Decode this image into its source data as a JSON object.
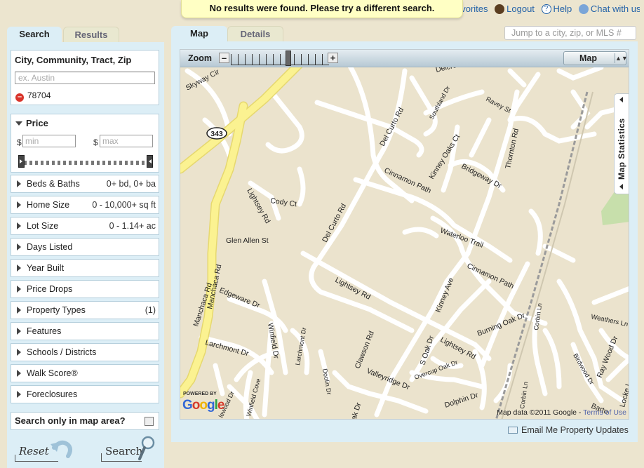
{
  "notice": "No results were found. Please try a different search.",
  "topnav": {
    "favorites": "avorites",
    "logout": "Logout",
    "help": "Help",
    "chat": "Chat with us"
  },
  "left_tabs": [
    "Search",
    "Results"
  ],
  "right_tabs": [
    "Map",
    "Details"
  ],
  "jump_placeholder": "Jump to a city, zip, or MLS #",
  "location": {
    "title": "City, Community, Tract, Zip",
    "placeholder": "ex. Austin",
    "chip": "78704"
  },
  "price": {
    "title": "Price",
    "min_placeholder": "min",
    "max_placeholder": "max",
    "currency": "$"
  },
  "filters": [
    {
      "label": "Beds & Baths",
      "value": "0+ bd, 0+ ba"
    },
    {
      "label": "Home Size",
      "value": "0 - 10,000+ sq ft"
    },
    {
      "label": "Lot Size",
      "value": "0 - 1.14+ ac"
    },
    {
      "label": "Days Listed",
      "value": ""
    },
    {
      "label": "Year Built",
      "value": ""
    },
    {
      "label": "Price Drops",
      "value": ""
    },
    {
      "label": "Property Types",
      "value": "(1)"
    },
    {
      "label": "Features",
      "value": ""
    },
    {
      "label": "Schools / Districts",
      "value": ""
    },
    {
      "label": "Walk Score®",
      "value": ""
    },
    {
      "label": "Foreclosures",
      "value": ""
    }
  ],
  "map_area_label": "Search only in map area?",
  "buttons": {
    "reset": "Reset",
    "search": "Search"
  },
  "map": {
    "zoom_label": "Zoom",
    "zoom_minus": "–",
    "zoom_plus": "+",
    "type": "Map",
    "stats": "Map Statistics",
    "powered": "POWERED BY",
    "google": "Google",
    "data_text": "Map data ©2011 Google -",
    "terms": "Terms of Use",
    "highway": "343",
    "streets": {
      "manchaca": "Manchaca Rd",
      "manchaca2": "Manchaca Rd",
      "skyway": "Skyway Cir",
      "delcurto": "Del Curto Rd",
      "delcurto2": "Del Curto Rd",
      "cinnamon": "Cinnamon Path",
      "cinnamon2": "Cinnamon Path",
      "waterloo": "Waterloo Trail",
      "lightsey": "Lightsey Rd",
      "lightsey2": "Lightsey Rd",
      "lightsey3": "Lightsey Rd",
      "cody": "Cody Ct",
      "glenallen": "Glen Allen St",
      "edgeware": "Edgeware Dr",
      "winfield": "Winfield Dr",
      "winfieldcove": "Winfield Cove",
      "larchmont": "Larchmont Dr",
      "larchmont2": "Larchmont Dr",
      "kinneyoaks": "Kinney Oaks Ct",
      "kinneyave": "Kinney Ave",
      "bridgeway": "Bridgeway Dr",
      "thornton": "Thornton Rd",
      "ravey": "Ravey St",
      "southland": "Southland Dr",
      "delcrest": "Delcre",
      "burningoak": "Burning Oak Dr",
      "soak": "S Oak Dr",
      "overcup": "Overcup Oak Dr",
      "clawson": "Clawson Rd",
      "valleyridge": "Valleyridge Dr",
      "dolphin": "Dolphin Dr",
      "doolin": "Doolin Dr",
      "corbin": "Corbin Ln",
      "corbin2": "Corbin Ln",
      "weathers": "Weathers Ln",
      "raywood": "Ray Wood Dr",
      "birdwood": "Birdwood Dr",
      "barton": "Barto",
      "locke": "Locke L",
      "oak": "ak Dr",
      "elwood": "lewood Dr"
    }
  },
  "email_updates": "Email Me Property Updates"
}
